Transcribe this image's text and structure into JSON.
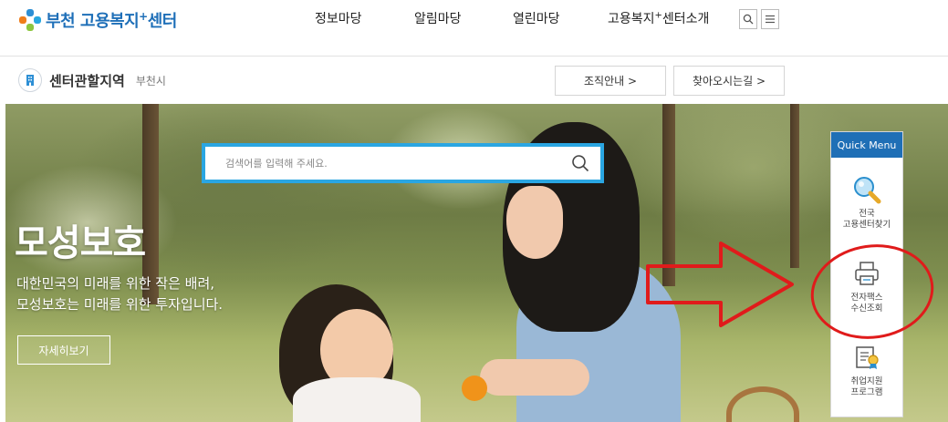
{
  "header": {
    "logo": {
      "name": "부천 고용복지",
      "sup": "+",
      "tail": "센터"
    },
    "nav": [
      {
        "label": "정보마당"
      },
      {
        "label": "알림마당"
      },
      {
        "label": "열린마당"
      },
      {
        "label": "고용복지",
        "sup": "+",
        "tail": "센터소개"
      }
    ],
    "search_icon": "search-icon",
    "menu_icon": "hamburger-icon"
  },
  "subbar": {
    "title": "센터관할지역",
    "subtitle": "부천시",
    "buttons": [
      {
        "label": "조직안내 >"
      },
      {
        "label": "찾아오시는길 >"
      }
    ]
  },
  "hero": {
    "search_placeholder": "검색어를 입력해 주세요.",
    "title": "모성보호",
    "desc_line1": "대한민국의 미래를 위한 작은 배려,",
    "desc_line2": "모성보호는 미래를 위한 투자입니다.",
    "more_label": "자세히보기"
  },
  "quick_menu": {
    "title": "Quick Menu",
    "items": [
      {
        "line1": "전국",
        "line2": "고용센터찾기",
        "icon": "magnifier-icon"
      },
      {
        "line1": "전자팩스",
        "line2": "수신조회",
        "icon": "fax-icon"
      },
      {
        "line1": "취업지원",
        "line2": "프로그램",
        "icon": "certificate-icon"
      }
    ]
  },
  "colors": {
    "brand_blue": "#1e6fb8",
    "search_border": "#2aa6e2",
    "quick_head": "#1f6fb6",
    "annotation_red": "#e01b1b"
  }
}
